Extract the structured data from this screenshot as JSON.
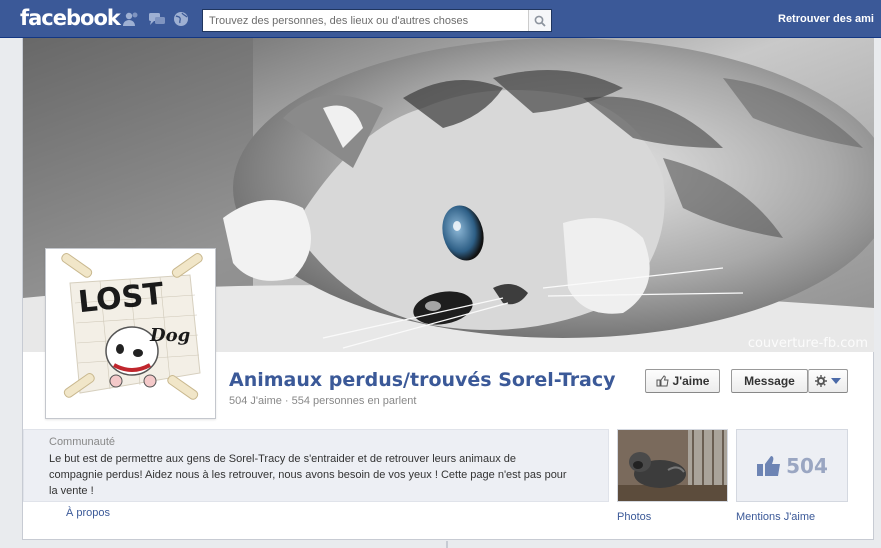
{
  "header": {
    "logo": "facebook",
    "search": {
      "placeholder": "Trouvez des personnes, des lieux ou d'autres choses"
    },
    "find_friends": "Retrouver des ami"
  },
  "cover": {
    "credit": "couverture-fb.com"
  },
  "profile": {
    "logo_text_1": "LOST",
    "logo_text_2": "Dog"
  },
  "page": {
    "name": "Animaux perdus/trouvés Sorel-Tracy",
    "stats": "504 J'aime · 554 personnes en parlent",
    "like_button": "J'aime",
    "message_button": "Message"
  },
  "about": {
    "category": "Communauté",
    "description": "Le but est de permettre aux gens de Sorel-Tracy de s'entraider et de retrouver leurs animaux de compagnie perdus! Aidez nous à les retrouver, nous avons besoin de vos yeux ! Cette page n'est pas pour la vente !",
    "link": "À propos"
  },
  "tiles": {
    "photos_label": "Photos",
    "likes_count": "504",
    "likes_label": "Mentions J'aime"
  },
  "colors": {
    "brand": "#3b5998",
    "link": "#3b5998"
  }
}
